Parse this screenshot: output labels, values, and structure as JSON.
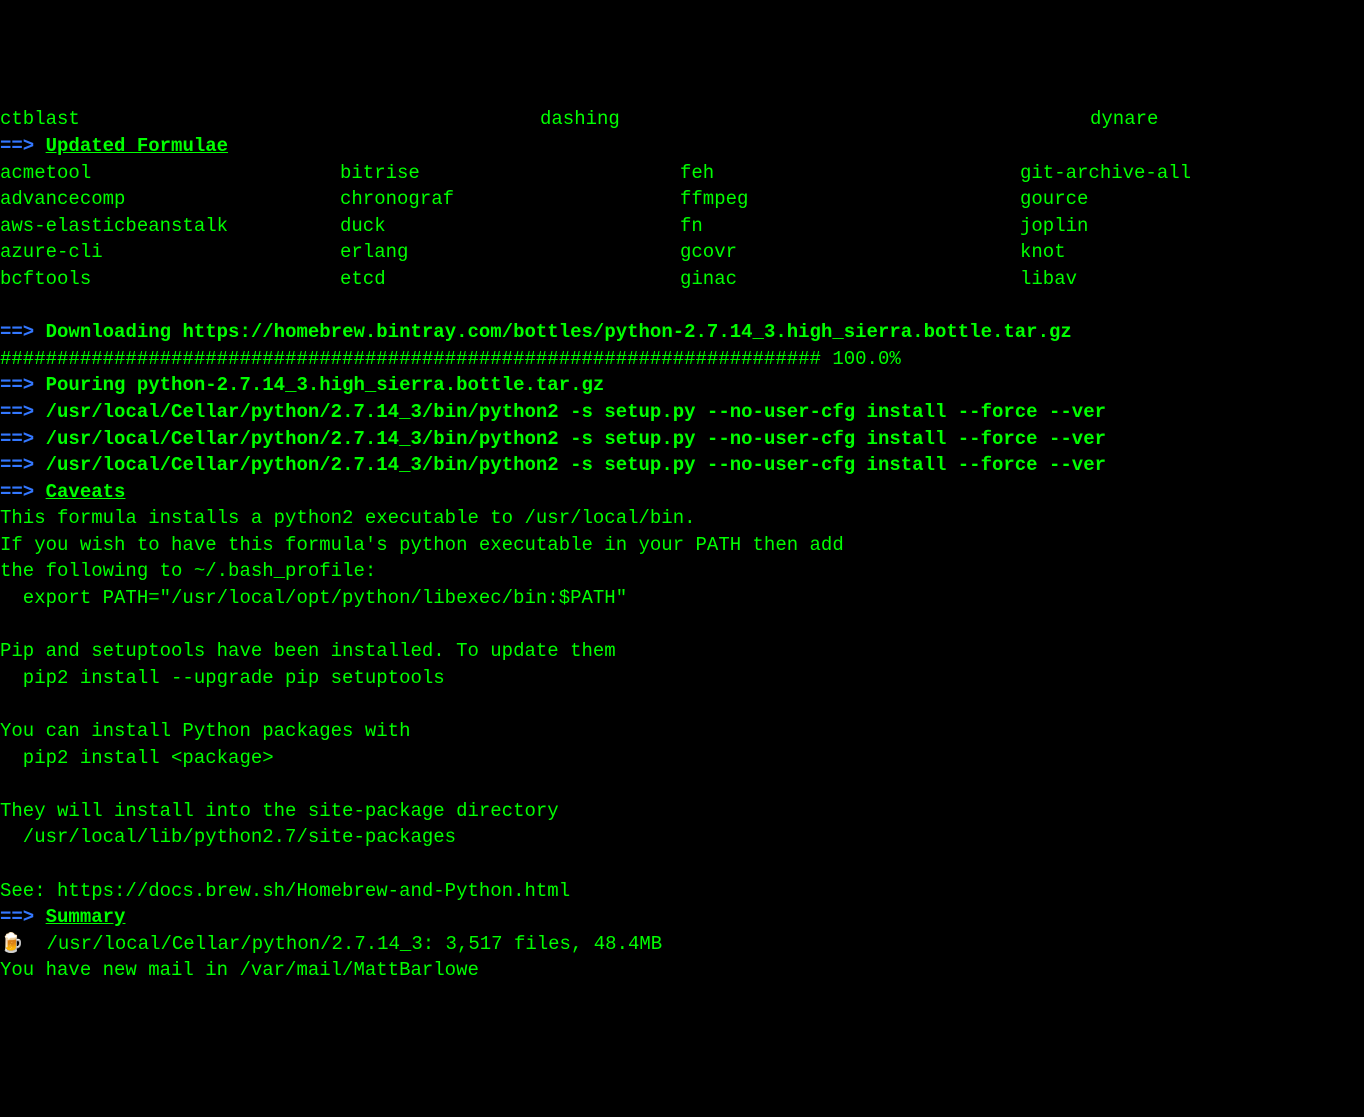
{
  "top_partial": {
    "col1": "ctblast",
    "col2": "dashing",
    "col3": "dynare"
  },
  "arrow": "==>",
  "updated_formulae_header": "Updated Formulae",
  "formulae": {
    "col1": [
      "acmetool",
      "advancecomp",
      "aws-elasticbeanstalk",
      "azure-cli",
      "bcftools"
    ],
    "col2": [
      "bitrise",
      "chronograf",
      "duck",
      "erlang",
      "etcd"
    ],
    "col3": [
      "feh",
      "ffmpeg",
      "fn",
      "gcovr",
      "ginac"
    ],
    "col4": [
      "git-archive-all",
      "gource",
      "joplin",
      "knot",
      "libav"
    ]
  },
  "downloading": {
    "label": "Downloading",
    "url": "https://homebrew.bintray.com/bottles/python-2.7.14_3.high_sierra.bottle.tar.gz"
  },
  "progress": {
    "bar": "########################################################################",
    "pct": "100.0%"
  },
  "pouring": {
    "label": "Pouring",
    "file": "python-2.7.14_3.high_sierra.bottle.tar.gz"
  },
  "setup_cmd": "/usr/local/Cellar/python/2.7.14_3/bin/python2 -s setup.py --no-user-cfg install --force --ver",
  "caveats_header": "Caveats",
  "caveats_lines": [
    "This formula installs a python2 executable to /usr/local/bin.",
    "If you wish to have this formula's python executable in your PATH then add",
    "the following to ~/.bash_profile:",
    "  export PATH=\"/usr/local/opt/python/libexec/bin:$PATH\"",
    "",
    "Pip and setuptools have been installed. To update them",
    "  pip2 install --upgrade pip setuptools",
    "",
    "You can install Python packages with",
    "  pip2 install <package>",
    "",
    "They will install into the site-package directory",
    "  /usr/local/lib/python2.7/site-packages",
    "",
    "See: https://docs.brew.sh/Homebrew-and-Python.html"
  ],
  "summary_header": "Summary",
  "beer_icon": "🍺",
  "summary_line": "/usr/local/Cellar/python/2.7.14_3: 3,517 files, 48.4MB",
  "mail_line": "You have new mail in /var/mail/MattBarlowe"
}
